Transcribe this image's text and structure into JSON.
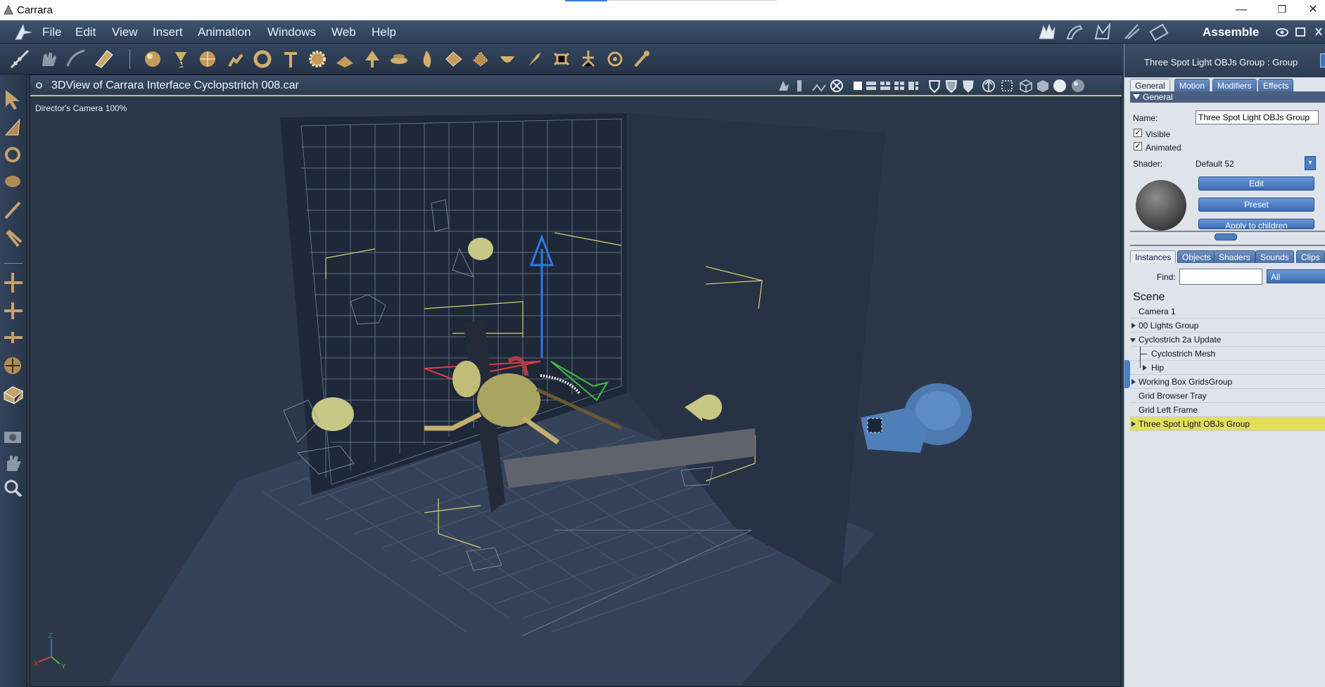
{
  "window": {
    "title": "Carrara",
    "minimize": "—",
    "restore": "❐",
    "close": "✕"
  },
  "menu": {
    "items": [
      "File",
      "Edit",
      "View",
      "Insert",
      "Animation",
      "Windows",
      "Web",
      "Help"
    ],
    "room": "Assemble"
  },
  "viewport": {
    "title": "3DView of Carrara Interface Cyclopstritch 008.car",
    "camera_label": "Director's Camera 100%"
  },
  "panel": {
    "title": "Three Spot Light OBJs Group : Group",
    "tabs": [
      "General",
      "Motion",
      "Modifiers",
      "Effects"
    ],
    "section": "General",
    "name_label": "Name:",
    "name_value": "Three Spot Light OBJs Group",
    "visible_label": "Visible",
    "animated_label": "Animated",
    "shader_label": "Shader:",
    "shader_value": "Default 52",
    "buttons": {
      "edit": "Edit",
      "preset": "Preset",
      "apply": "Apply to children"
    },
    "browser_tabs": [
      "Instances",
      "Objects",
      "Shaders",
      "Sounds",
      "Clips"
    ],
    "find_label": "Find:",
    "find_value": "",
    "filter_value": "All",
    "scene_header": "Scene",
    "tree": [
      {
        "label": "Camera 1"
      },
      {
        "label": "00 Lights Group"
      },
      {
        "label": "Cyclostrich 2a Update"
      },
      {
        "label": "Cyclostrich Mesh"
      },
      {
        "label": "Hip"
      },
      {
        "label": "Working Box GridsGroup"
      },
      {
        "label": "Grid Browser Tray"
      },
      {
        "label": "Grid Left Frame"
      },
      {
        "label": "Three Spot Light OBJs Group"
      }
    ]
  },
  "colors": {
    "selected_row": "#e3de5c",
    "viewport_bg": "#2c3849",
    "accent_yellow": "#c8c25a"
  },
  "axis": {
    "z": "Z",
    "x": "X",
    "y": "Y"
  }
}
